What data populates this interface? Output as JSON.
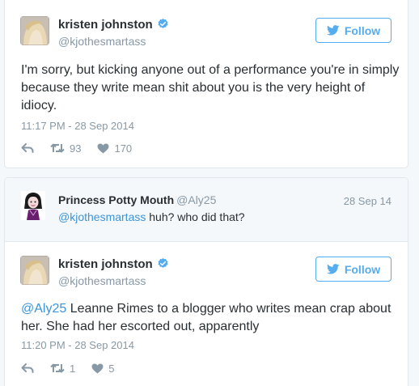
{
  "tweet1": {
    "name": "kristen johnston",
    "handle": "@kjothesmartass",
    "follow_label": "Follow",
    "text": "I'm sorry, but kicking anyone out of a performance you're in simply because they write mean shit about you is the very height of idiocy.",
    "timestamp": "11:17 PM - 28 Sep 2014",
    "retweets": "93",
    "likes": "170"
  },
  "reply": {
    "name": "Princess Potty Mouth",
    "handle": "@Aly25",
    "date": "28 Sep 14",
    "mention": "@kjothesmartass",
    "text": " huh? who did that?"
  },
  "tweet2": {
    "name": "kristen johnston",
    "handle": "@kjothesmartass",
    "follow_label": "Follow",
    "mention": "@Aly25",
    "text": " Leanne Rimes to a blogger who writes mean crap about her. She had her escorted out, apparently",
    "timestamp": "11:20 PM - 28 Sep 2014",
    "retweets": "1",
    "likes": "5"
  },
  "icons": {
    "verified": "verified-badge-icon",
    "bird": "twitter-bird-icon",
    "reply": "reply-arrow-icon",
    "retweet": "retweet-icon",
    "like": "heart-icon"
  },
  "colors": {
    "accent": "#55acee",
    "link": "#3b94d9",
    "muted": "#8899a6",
    "text": "#292f33",
    "border": "#e1e8ed",
    "background": "#f5f8fa"
  }
}
